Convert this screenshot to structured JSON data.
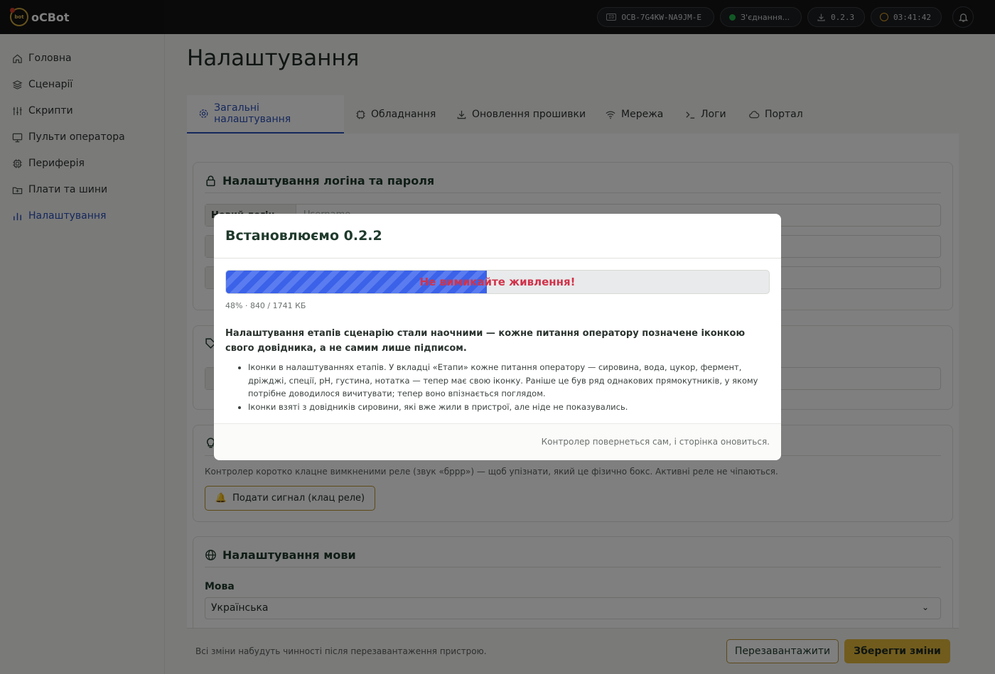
{
  "brand": {
    "name": "oCBot",
    "logo_text": "bot"
  },
  "topbar": {
    "device_id": "OCB-7G4KW-NA9JM-E",
    "device_id_icon": "ID",
    "connection": "З'єднання...",
    "version": "0.2.3",
    "uptime": "03:41:42"
  },
  "sidebar": {
    "items": [
      {
        "label": "Головна",
        "icon": "home-icon"
      },
      {
        "label": "Сценарії",
        "icon": "layers-icon"
      },
      {
        "label": "Скрипти",
        "icon": "sliders-icon"
      },
      {
        "label": "Пульти оператора",
        "icon": "monitor-icon"
      },
      {
        "label": "Периферія",
        "icon": "chip-icon"
      },
      {
        "label": "Плати та шини",
        "icon": "board-icon"
      },
      {
        "label": "Налаштування",
        "icon": "chart-icon",
        "active": true
      }
    ]
  },
  "page": {
    "title": "Налаштування"
  },
  "tabs": [
    {
      "label": "Загальні налаштування",
      "icon": "gear-icon",
      "active": true
    },
    {
      "label": "Обладнання",
      "icon": "chip-icon"
    },
    {
      "label": "Оновлення прошивки",
      "icon": "download-icon"
    },
    {
      "label": "Мережа",
      "icon": "wifi-icon"
    },
    {
      "label": "Логи",
      "icon": "terminal-icon"
    },
    {
      "label": "Портал",
      "icon": "cloud-icon"
    }
  ],
  "login_card": {
    "title": "Налаштування логіна та пароля",
    "new_login_label": "Новий логін",
    "new_login_placeholder": "Username"
  },
  "identify_card": {
    "text": "Контролер коротко клацне вимкненими реле (звук «бррр») — щоб упізнати, який це фізично бокс. Активні реле не чіпаються.",
    "button_label": "Подати сигнал (клац реле)"
  },
  "language_card": {
    "title": "Налаштування мови",
    "label": "Мова",
    "value": "Українська"
  },
  "footer": {
    "note": "Всі зміни набудуть чинності після перезавантаження пристрою.",
    "reboot_label": "Перезавантажити",
    "save_label": "Зберегти зміни"
  },
  "modal": {
    "title": "Встановлюємо 0.2.2",
    "warning": "Не вимикайте живлення!",
    "progress": 0.48,
    "progress_meta": "48% · 840 / 1741 КБ",
    "headline": "Налаштування етапів сценарію стали наочними — кожне питання оператору позначене іконкою свого довідника, а не самим лише підписом.",
    "bullets": [
      "Іконки в налаштуваннях етапів. У вкладці «Етапи» кожне питання оператору — сировина, вода, цукор, фермент, дріжджі, спеції, pH, густина, нотатка — тепер має свою іконку. Раніше це був ряд однакових прямокутників, у якому потрібне доводилося вичитувати; тепер воно впізнається поглядом.",
      "Іконки взяті з довідників сировини, які вже жили в пристрої, але ніде не показувались."
    ],
    "footer_note": "Контролер повернеться сам, і сторінка оновиться."
  },
  "colors": {
    "accent_gold": "#e3b83a",
    "accent_blue": "#2a50b8",
    "progress_blue": "#3b62e8",
    "warning_red": "#d1324a",
    "status_green": "#22b04b"
  }
}
